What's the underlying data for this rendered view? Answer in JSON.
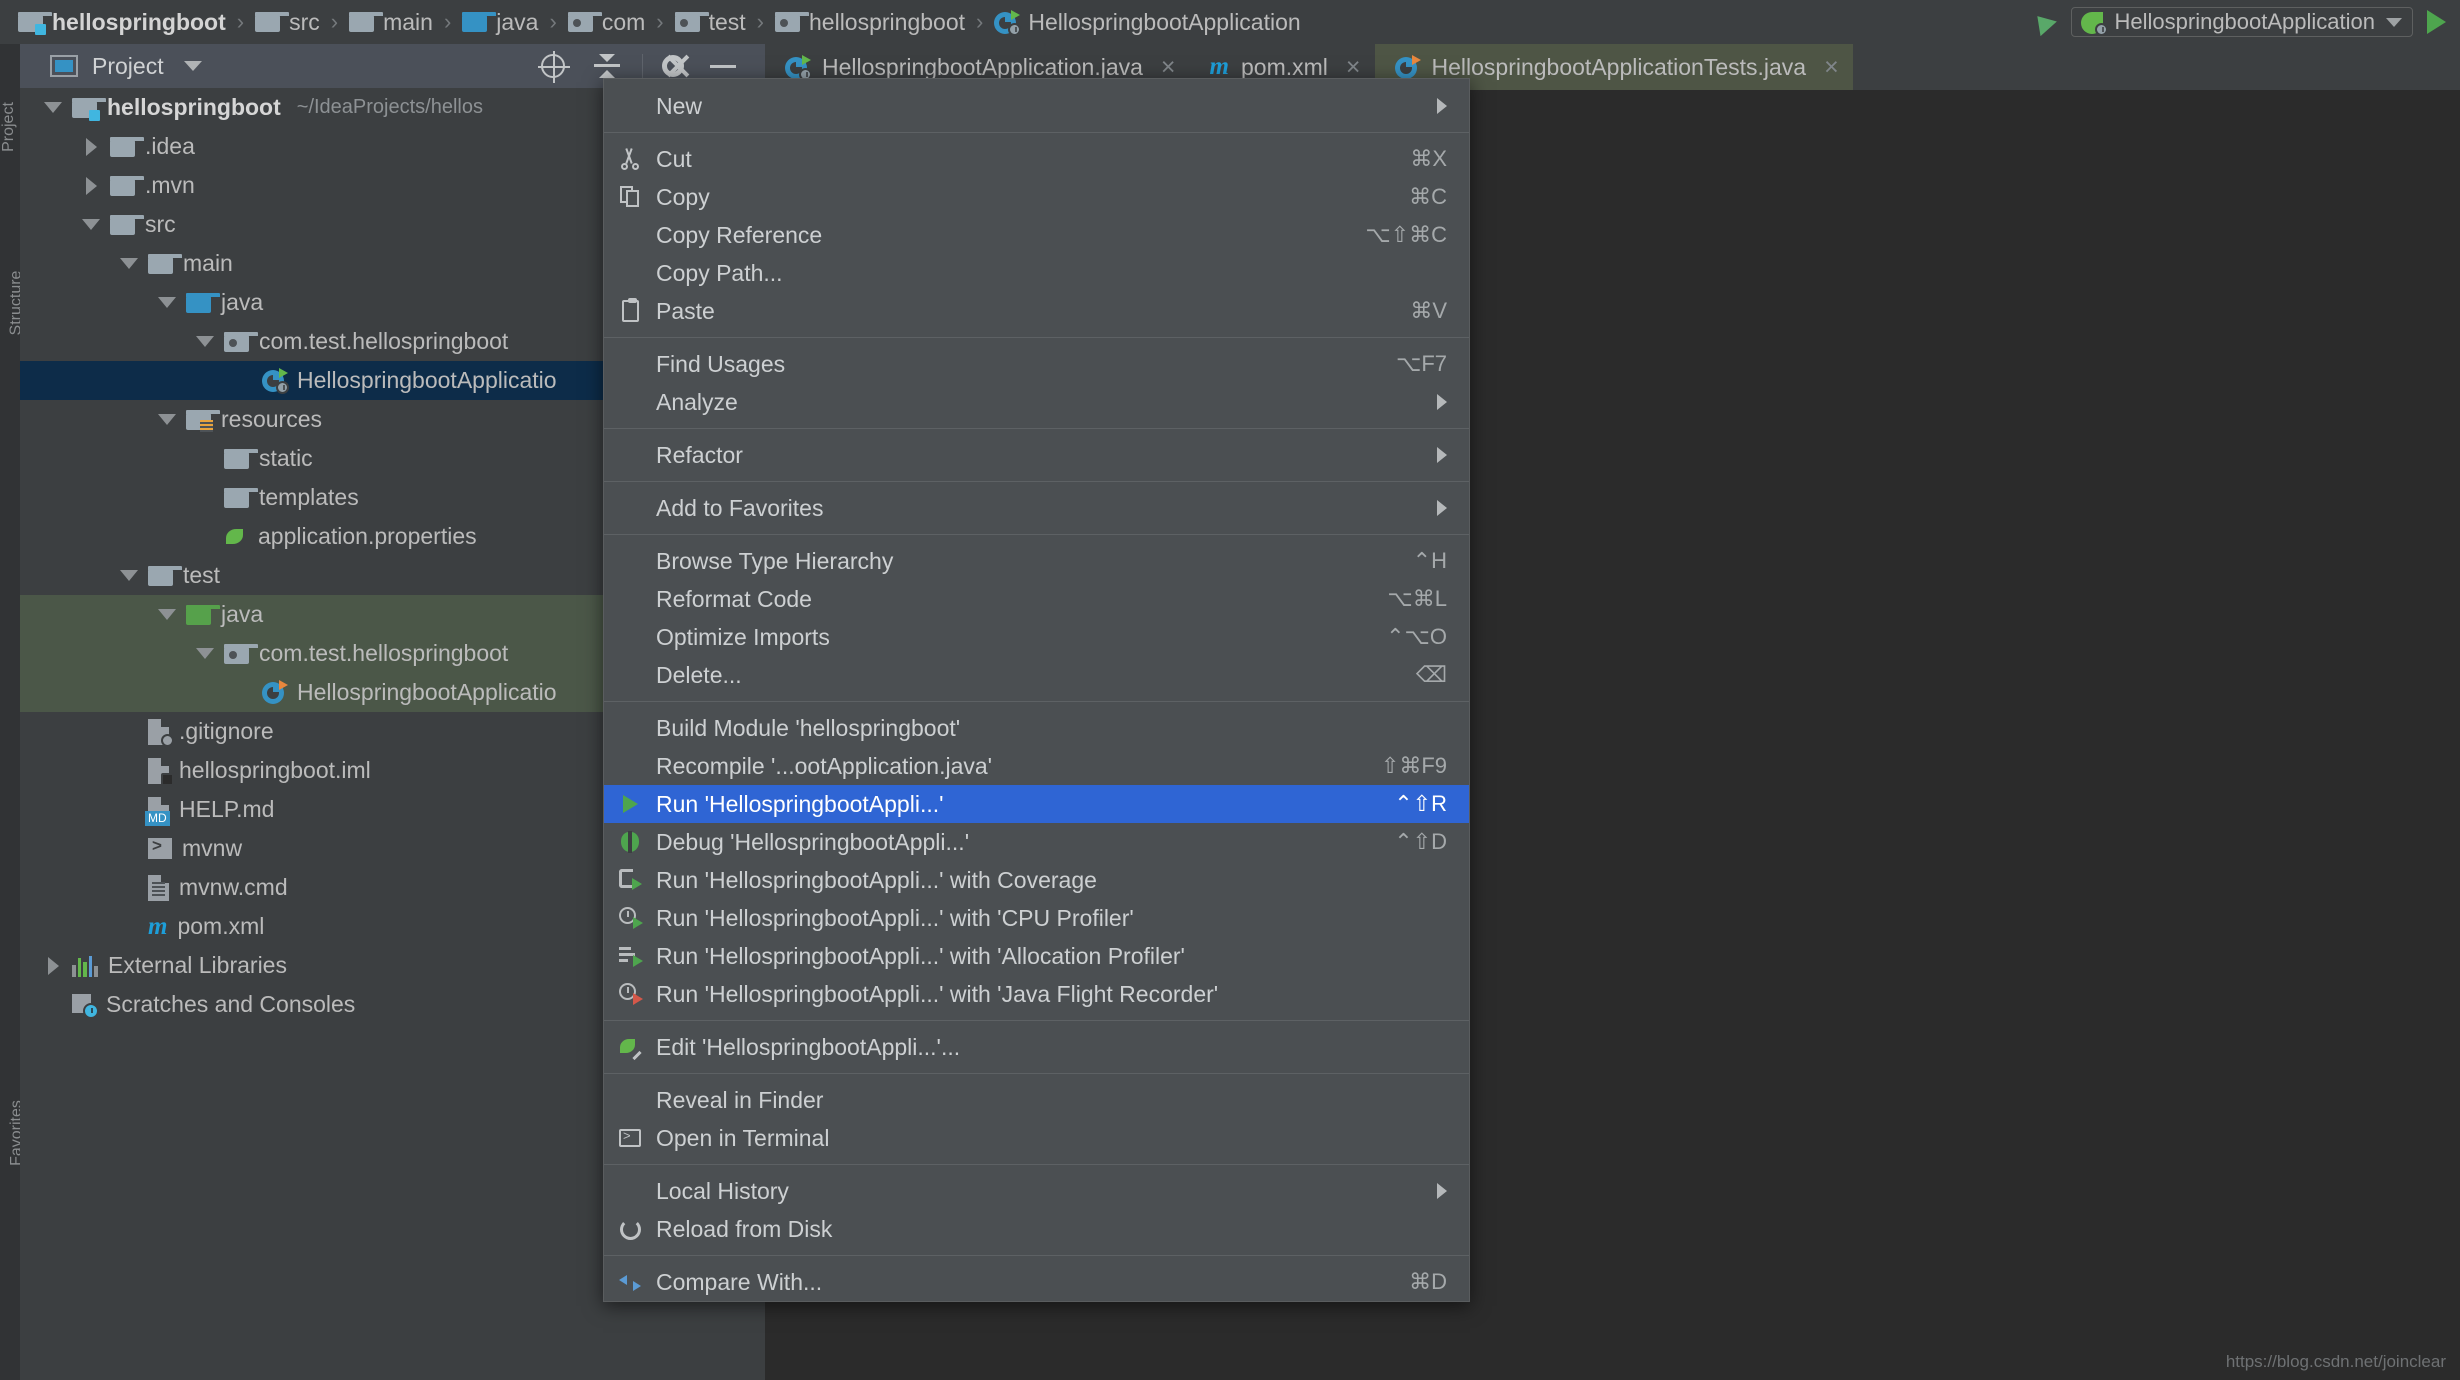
{
  "breadcrumb": {
    "items": [
      {
        "label": "hellospringboot",
        "icon": "module-folder-icon",
        "type": "module"
      },
      {
        "label": "src",
        "icon": "folder-icon",
        "type": "folder"
      },
      {
        "label": "main",
        "icon": "folder-icon",
        "type": "folder"
      },
      {
        "label": "java",
        "icon": "source-folder-icon",
        "type": "source"
      },
      {
        "label": "com",
        "icon": "package-icon",
        "type": "package"
      },
      {
        "label": "test",
        "icon": "package-icon",
        "type": "package"
      },
      {
        "label": "hellospringboot",
        "icon": "package-icon",
        "type": "package"
      },
      {
        "label": "HellospringbootApplication",
        "icon": "spring-class-icon",
        "type": "class"
      }
    ],
    "separator": "›"
  },
  "toolbar": {
    "build_icon": "hammer-icon",
    "run_config": {
      "label": "HellospringbootApplication",
      "icon": "spring-leaf-icon",
      "dropdown_icon": "chevron-down-icon"
    },
    "run_button_icon": "run-play-icon"
  },
  "tool_window": {
    "title": "Project",
    "icon": "project-view-icon",
    "dropdown_icon": "chevron-down-icon",
    "actions": [
      {
        "name": "locate-icon",
        "title": "Select Opened File"
      },
      {
        "name": "collapse-all-icon",
        "title": "Collapse All"
      },
      {
        "name": "gear-icon",
        "title": "Settings"
      },
      {
        "name": "hide-icon",
        "title": "Hide"
      }
    ],
    "left_strip": [
      "Project",
      "Structure",
      "Favorites"
    ]
  },
  "tree": [
    {
      "label": "hellospringboot",
      "sub": "~/IdeaProjects/hellos",
      "indent": 0,
      "arrow": "down",
      "icon": "module-folder-icon",
      "bold": true,
      "state": "normal"
    },
    {
      "label": ".idea",
      "sub": "",
      "indent": 1,
      "arrow": "right",
      "icon": "folder-icon",
      "bold": false,
      "state": "normal"
    },
    {
      "label": ".mvn",
      "sub": "",
      "indent": 1,
      "arrow": "right",
      "icon": "folder-icon",
      "bold": false,
      "state": "normal"
    },
    {
      "label": "src",
      "sub": "",
      "indent": 1,
      "arrow": "down",
      "icon": "folder-icon",
      "bold": false,
      "state": "normal"
    },
    {
      "label": "main",
      "sub": "",
      "indent": 2,
      "arrow": "down",
      "icon": "folder-icon",
      "bold": false,
      "state": "normal"
    },
    {
      "label": "java",
      "sub": "",
      "indent": 3,
      "arrow": "down",
      "icon": "source-folder-icon",
      "bold": false,
      "state": "normal"
    },
    {
      "label": "com.test.hellospringboot",
      "sub": "",
      "indent": 4,
      "arrow": "down",
      "icon": "package-icon",
      "bold": false,
      "state": "normal"
    },
    {
      "label": "HellospringbootApplicatio",
      "sub": "",
      "indent": 5,
      "arrow": "none",
      "icon": "spring-class-icon",
      "bold": false,
      "state": "selected"
    },
    {
      "label": "resources",
      "sub": "",
      "indent": 3,
      "arrow": "down",
      "icon": "resources-folder-icon",
      "bold": false,
      "state": "normal"
    },
    {
      "label": "static",
      "sub": "",
      "indent": 4,
      "arrow": "none",
      "icon": "folder-icon",
      "bold": false,
      "state": "normal"
    },
    {
      "label": "templates",
      "sub": "",
      "indent": 4,
      "arrow": "none",
      "icon": "folder-icon",
      "bold": false,
      "state": "normal"
    },
    {
      "label": "application.properties",
      "sub": "",
      "indent": 4,
      "arrow": "none",
      "icon": "spring-properties-icon",
      "bold": false,
      "state": "normal"
    },
    {
      "label": "test",
      "sub": "",
      "indent": 2,
      "arrow": "down",
      "icon": "folder-icon",
      "bold": false,
      "state": "normal"
    },
    {
      "label": "java",
      "sub": "",
      "indent": 3,
      "arrow": "down",
      "icon": "test-source-folder-icon",
      "bold": false,
      "state": "band"
    },
    {
      "label": "com.test.hellospringboot",
      "sub": "",
      "indent": 4,
      "arrow": "down",
      "icon": "package-icon",
      "bold": false,
      "state": "band"
    },
    {
      "label": "HellospringbootApplicatio",
      "sub": "",
      "indent": 5,
      "arrow": "none",
      "icon": "spring-test-class-icon",
      "bold": false,
      "state": "band"
    },
    {
      "label": ".gitignore",
      "sub": "",
      "indent": 2,
      "arrow": "none",
      "icon": "gitignore-file-icon",
      "bold": false,
      "state": "normal"
    },
    {
      "label": "hellospringboot.iml",
      "sub": "",
      "indent": 2,
      "arrow": "none",
      "icon": "iml-file-icon",
      "bold": false,
      "state": "normal"
    },
    {
      "label": "HELP.md",
      "sub": "",
      "indent": 2,
      "arrow": "none",
      "icon": "markdown-file-icon",
      "bold": false,
      "state": "normal"
    },
    {
      "label": "mvnw",
      "sub": "",
      "indent": 2,
      "arrow": "none",
      "icon": "shell-script-icon",
      "bold": false,
      "state": "normal"
    },
    {
      "label": "mvnw.cmd",
      "sub": "",
      "indent": 2,
      "arrow": "none",
      "icon": "text-file-icon",
      "bold": false,
      "state": "normal"
    },
    {
      "label": "pom.xml",
      "sub": "",
      "indent": 2,
      "arrow": "none",
      "icon": "maven-file-icon",
      "bold": false,
      "state": "normal"
    },
    {
      "label": "External Libraries",
      "sub": "",
      "indent": 0,
      "arrow": "right",
      "icon": "libraries-icon",
      "bold": false,
      "state": "normal"
    },
    {
      "label": "Scratches and Consoles",
      "sub": "",
      "indent": 0,
      "arrow": "none",
      "icon": "scratches-icon",
      "bold": false,
      "state": "normal"
    }
  ],
  "tabs": [
    {
      "label": "HellospringbootApplication.java",
      "icon": "spring-class-icon",
      "active": false,
      "close_icon": "close-icon"
    },
    {
      "label": "pom.xml",
      "icon": "maven-file-icon",
      "active": false,
      "close_icon": "close-icon"
    },
    {
      "label": "HellospringbootApplicationTests.java",
      "icon": "spring-test-class-icon",
      "active": true,
      "close_icon": "close-icon"
    }
  ],
  "context_menu": [
    {
      "label": "New",
      "shortcut": "",
      "icon": "",
      "submenu": true,
      "highlight": false,
      "sep_after": true
    },
    {
      "label": "Cut",
      "shortcut": "⌘X",
      "icon": "scissors-icon",
      "submenu": false,
      "highlight": false,
      "sep_after": false
    },
    {
      "label": "Copy",
      "shortcut": "⌘C",
      "icon": "copy-icon",
      "submenu": false,
      "highlight": false,
      "sep_after": false
    },
    {
      "label": "Copy Reference",
      "shortcut": "⌥⇧⌘C",
      "icon": "",
      "submenu": false,
      "highlight": false,
      "sep_after": false
    },
    {
      "label": "Copy Path...",
      "shortcut": "",
      "icon": "",
      "submenu": false,
      "highlight": false,
      "sep_after": false
    },
    {
      "label": "Paste",
      "shortcut": "⌘V",
      "icon": "paste-icon",
      "submenu": false,
      "highlight": false,
      "sep_after": true
    },
    {
      "label": "Find Usages",
      "shortcut": "⌥F7",
      "icon": "",
      "submenu": false,
      "highlight": false,
      "sep_after": false
    },
    {
      "label": "Analyze",
      "shortcut": "",
      "icon": "",
      "submenu": true,
      "highlight": false,
      "sep_after": true
    },
    {
      "label": "Refactor",
      "shortcut": "",
      "icon": "",
      "submenu": true,
      "highlight": false,
      "sep_after": true
    },
    {
      "label": "Add to Favorites",
      "shortcut": "",
      "icon": "",
      "submenu": true,
      "highlight": false,
      "sep_after": true
    },
    {
      "label": "Browse Type Hierarchy",
      "shortcut": "⌃H",
      "icon": "",
      "submenu": false,
      "highlight": false,
      "sep_after": false
    },
    {
      "label": "Reformat Code",
      "shortcut": "⌥⌘L",
      "icon": "",
      "submenu": false,
      "highlight": false,
      "sep_after": false
    },
    {
      "label": "Optimize Imports",
      "shortcut": "⌃⌥O",
      "icon": "",
      "submenu": false,
      "highlight": false,
      "sep_after": false
    },
    {
      "label": "Delete...",
      "shortcut": "⌫",
      "icon": "",
      "submenu": false,
      "highlight": false,
      "sep_after": true
    },
    {
      "label": "Build Module 'hellospringboot'",
      "shortcut": "",
      "icon": "",
      "submenu": false,
      "highlight": false,
      "sep_after": false
    },
    {
      "label": "Recompile '...ootApplication.java'",
      "shortcut": "⇧⌘F9",
      "icon": "",
      "submenu": false,
      "highlight": false,
      "sep_after": false
    },
    {
      "label": "Run 'HellospringbootAppli...'",
      "shortcut": "⌃⇧R",
      "icon": "run-play-icon",
      "submenu": false,
      "highlight": true,
      "sep_after": false
    },
    {
      "label": "Debug 'HellospringbootAppli...'",
      "shortcut": "⌃⇧D",
      "icon": "debug-bug-icon",
      "submenu": false,
      "highlight": false,
      "sep_after": false
    },
    {
      "label": "Run 'HellospringbootAppli...' with Coverage",
      "shortcut": "",
      "icon": "coverage-icon",
      "submenu": false,
      "highlight": false,
      "sep_after": false
    },
    {
      "label": "Run 'HellospringbootAppli...' with 'CPU Profiler'",
      "shortcut": "",
      "icon": "cpu-profiler-icon",
      "submenu": false,
      "highlight": false,
      "sep_after": false
    },
    {
      "label": "Run 'HellospringbootAppli...' with 'Allocation Profiler'",
      "shortcut": "",
      "icon": "allocation-profiler-icon",
      "submenu": false,
      "highlight": false,
      "sep_after": false
    },
    {
      "label": "Run 'HellospringbootAppli...' with 'Java Flight Recorder'",
      "shortcut": "",
      "icon": "flight-recorder-icon",
      "submenu": false,
      "highlight": false,
      "sep_after": true
    },
    {
      "label": "Edit 'HellospringbootAppli...'...",
      "shortcut": "",
      "icon": "edit-config-icon",
      "submenu": false,
      "highlight": false,
      "sep_after": true
    },
    {
      "label": "Reveal in Finder",
      "shortcut": "",
      "icon": "",
      "submenu": false,
      "highlight": false,
      "sep_after": false
    },
    {
      "label": "Open in Terminal",
      "shortcut": "",
      "icon": "terminal-icon",
      "submenu": false,
      "highlight": false,
      "sep_after": true
    },
    {
      "label": "Local History",
      "shortcut": "",
      "icon": "",
      "submenu": true,
      "highlight": false,
      "sep_after": false
    },
    {
      "label": "Reload from Disk",
      "shortcut": "",
      "icon": "reload-icon",
      "submenu": false,
      "highlight": false,
      "sep_after": true
    },
    {
      "label": "Compare With...",
      "shortcut": "⌘D",
      "icon": "compare-icon",
      "submenu": false,
      "highlight": false,
      "sep_after": false
    }
  ],
  "watermark": "https://blog.csdn.net/joinclear",
  "colors": {
    "background": "#3c3f41",
    "editor_background": "#2b2b2b",
    "menu_background": "#4b4f52",
    "highlight_blue": "#2f65d4",
    "selection_blue": "#0d2c49",
    "test_band_green": "#4b5748",
    "active_tab_green": "#4e5545",
    "accent_green": "#4ea54e",
    "source_blue": "#3592c4"
  }
}
